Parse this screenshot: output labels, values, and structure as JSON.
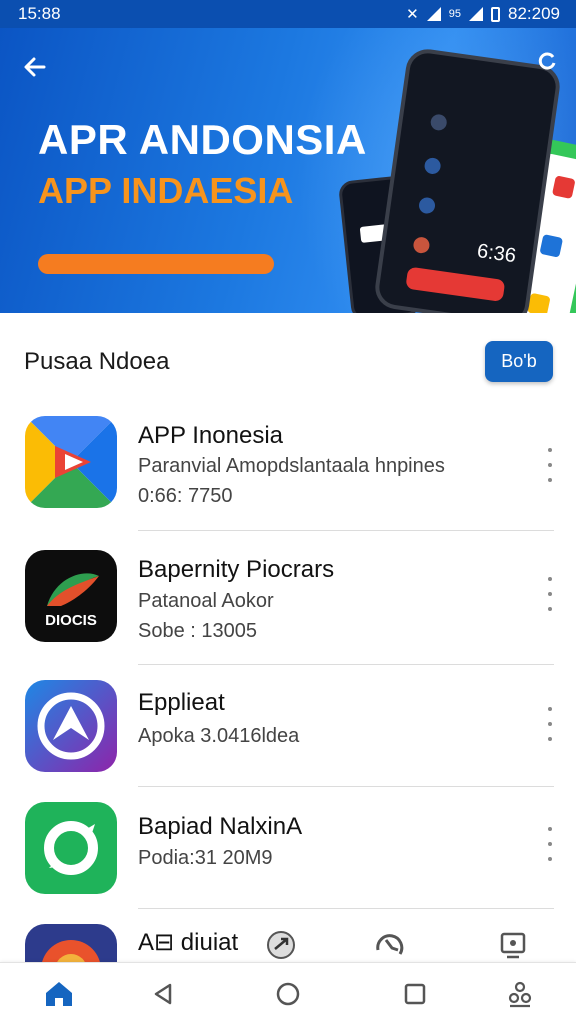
{
  "status_bar": {
    "time": "15:88",
    "right_text": "82:209",
    "signal_label": "95"
  },
  "banner": {
    "title": "APR ANDONSIA",
    "subtitle": "APP INDAESIA",
    "phone_clock": "6:36"
  },
  "section": {
    "title": "Pusaa Ndoea",
    "button_label": "Bo'b"
  },
  "apps": [
    {
      "name": "APP Inonesia",
      "line1": "Paranvial Amopdslantaala hnpines",
      "line2": "0:66: 7750"
    },
    {
      "name": "Bapernity Piocrars",
      "line1": "Patanoal Aokor",
      "line2": "Sobe : 13005",
      "icon_text": "DIOCIS"
    },
    {
      "name": "Epplieat",
      "line1": "Apoka 3.0416ldea"
    },
    {
      "name": "Bapiad NalxinA",
      "line1": "Podia:31 20M9"
    },
    {
      "name": "A⊟ diuiat"
    }
  ],
  "colors": {
    "brand_blue": "#1565c0",
    "banner_orange": "#f7941d",
    "nav_active": "#1565c0"
  },
  "icons": {
    "back": "arrow-left-icon",
    "refresh": "refresh-icon",
    "more": "more-vertical-icon",
    "nav": [
      "home-icon",
      "back-triangle-icon",
      "home-circle-icon",
      "recents-square-icon",
      "accessibility-icon"
    ]
  }
}
